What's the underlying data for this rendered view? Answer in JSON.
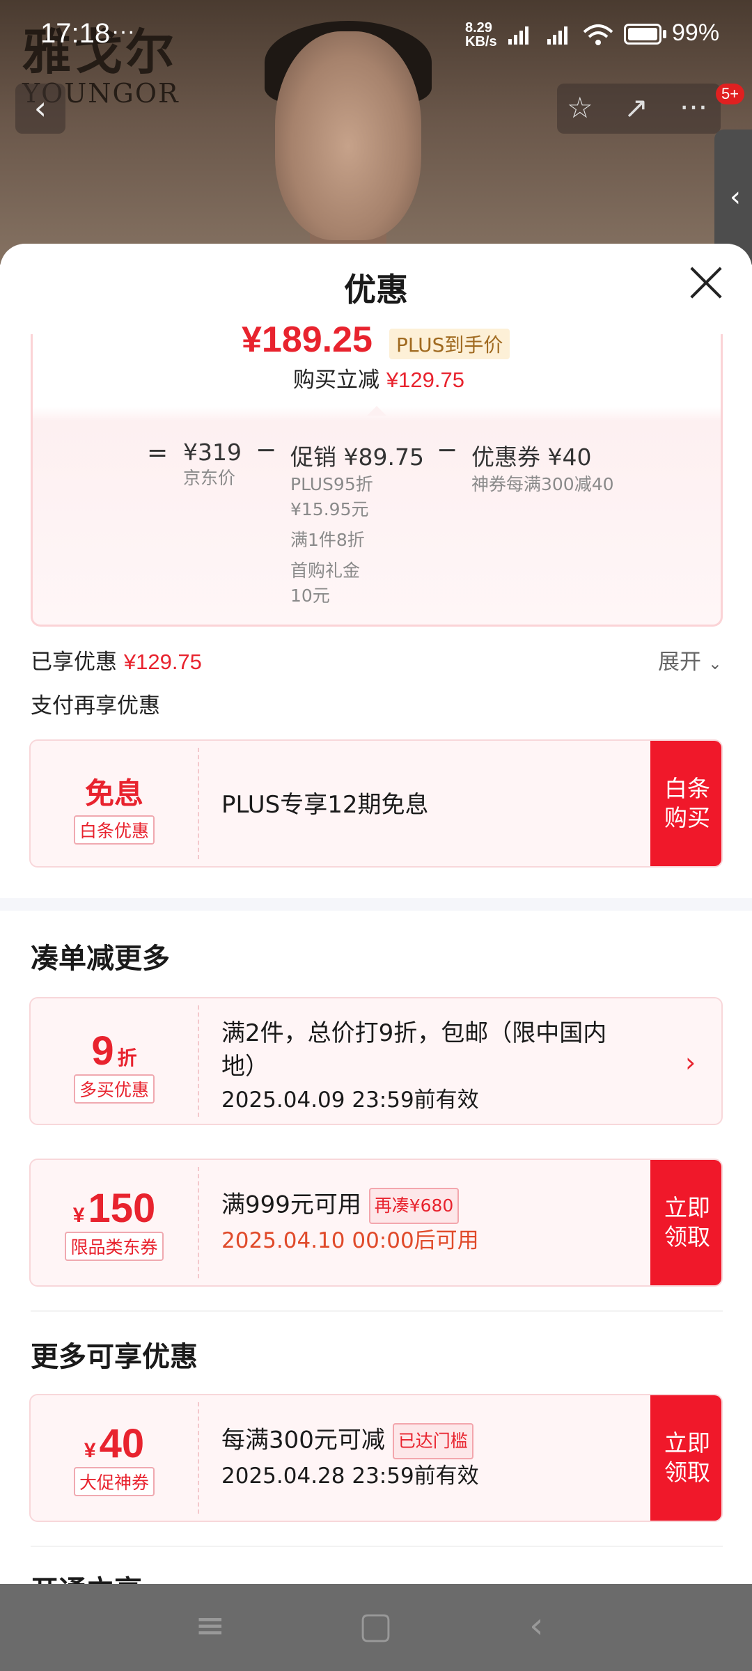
{
  "status_bar": {
    "time": "17:18",
    "menu_dots": "···",
    "net_speed_value": "8.29",
    "net_speed_unit": "KB/s",
    "battery_pct": "99%"
  },
  "header": {
    "brand_cn": "雅戈尔",
    "brand_en": "YOUNGOR",
    "back_icon": "‹",
    "star_icon": "☆",
    "share_icon": "↗",
    "more_icon": "···",
    "notification_badge": "5+",
    "side_tab_icon": "‹"
  },
  "sheet": {
    "title": "优惠",
    "close_icon": "close-icon"
  },
  "price_breakdown": {
    "final_price": "¥189.25",
    "final_tag": "PLUS到手价",
    "reduce_label": "购买立减",
    "reduce_amount": "¥129.75",
    "equals": "=",
    "jd_price": "¥319",
    "jd_price_label": "京东价",
    "minus1": "−",
    "promo_label": "促销 ¥89.75",
    "promo_line1": "PLUS95折",
    "promo_line2": "¥15.95元",
    "promo_line3": "满1件8折",
    "promo_line4": "首购礼金",
    "promo_line5": "10元",
    "minus2": "−",
    "coupon_label": "优惠券 ¥40",
    "coupon_sub": "神券每满300减40"
  },
  "enjoyed": {
    "label": "已享优惠",
    "amount": "¥129.75",
    "expand": "展开",
    "pay_more": "支付再享优惠"
  },
  "baitiao": {
    "big": "免息",
    "tag": "白条优惠",
    "main": "PLUS专享12期免息",
    "btn_line1": "白条",
    "btn_line2": "购买"
  },
  "section_more": {
    "title": "凑单减更多"
  },
  "discount9": {
    "big": "9",
    "unit": "折",
    "tag": "多买优惠",
    "line1": "满2件，总价打9折，包邮（限中国内",
    "line2": "地）",
    "line3": "2025.04.09 23:59前有效",
    "chevron": "›"
  },
  "coupon150": {
    "currency": "¥",
    "amount": "150",
    "tag": "限品类东券",
    "line1": "满999元可用",
    "badge": "再凑¥680",
    "line2": "2025.04.10 00:00后可用",
    "btn_line1": "立即",
    "btn_line2": "领取"
  },
  "section_available": {
    "title": "更多可享优惠"
  },
  "coupon40": {
    "currency": "¥",
    "amount": "40",
    "tag": "大促神券",
    "line1": "每满300元可减",
    "badge": "已达门槛",
    "line2": "2025.04.28 23:59前有效",
    "btn_line1": "立即",
    "btn_line2": "领取"
  },
  "section_partial": {
    "title": "开通立享"
  },
  "nav": {
    "menu_icon": "≡",
    "home_icon": "▢",
    "back_icon": "‹"
  },
  "colors": {
    "accent_red": "#e8232e",
    "button_red": "#f0182a"
  }
}
